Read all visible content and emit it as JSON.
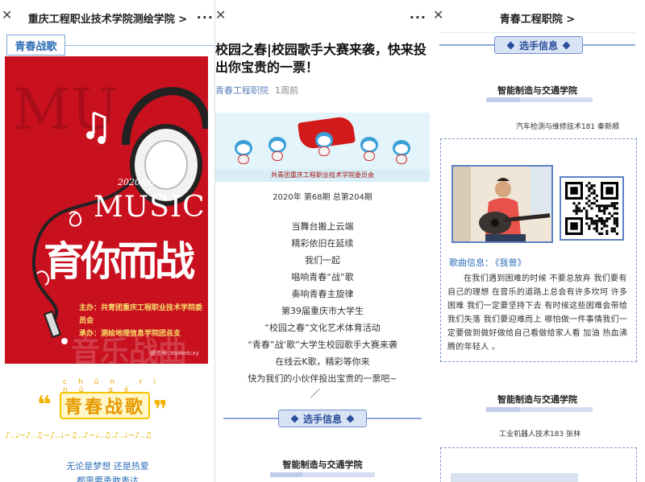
{
  "panel1": {
    "header_title": "重庆工程职业技术学院测绘学院 >",
    "close_glyph": "✕",
    "more_glyph": "···",
    "section_tag": "青春战歌",
    "poster": {
      "date": "2020/06",
      "music": "MUSIC",
      "big_title": "育你而战",
      "organizer": "主办：共青团重庆工程职业技术学院委员会",
      "undertaker": "承办：测绘地理信息学院团总支",
      "wechat": "微信号: cqviedcxy",
      "ghost_text": "音乐战曲"
    },
    "art_title": {
      "pinyin": "chūn rì nǔ gē",
      "text": "青春战歌",
      "quote_left": "❝",
      "quote_right": "❞"
    },
    "notes": "♪..♩~♪..♫~♪..♩~♫..♪~♩..♫.♪..♩~♪..♫",
    "line1": "无论是梦想 还是热爱",
    "line2": "都需要勇敢表达"
  },
  "panel2": {
    "close_glyph": "✕",
    "more_glyph": "···",
    "article_title": "校园之春|校园歌手大赛来袭，快来投出你宝贵的一票！",
    "source": "青春工程职院",
    "time": "1周前",
    "banner_caption": "共青团重庆工程职业技术学院委员会",
    "issue": "2020年 第68期 总第204期",
    "verses": [
      "当舞台搬上云端",
      "精彩依旧在延续",
      "我们一起",
      "唱响青春“战”歌",
      "奏响青春主旋律",
      "第39届重庆市大学生",
      "“校园之春”文化艺术体育活动",
      "“青春”战‘歌”大学生校园歌手大赛来袭",
      "在线云K歌，精彩等你来",
      "快为我们的小伙伴投出宝贵的一票吧~"
    ],
    "slash": "／",
    "section_label": "选手信息",
    "school": "智能制造与交通学院"
  },
  "panel3": {
    "close_glyph": "✕",
    "header_title": "青春工程职院 >",
    "section_label": "选手信息",
    "school1": "智能制造与交通学院",
    "student1": "汽车检测与维修技术181 秦新顺",
    "song_label": "歌曲信息：",
    "song_name": "《我曾》",
    "lyrics": "在我们遇到困难的时候 不要总放弃 我们要有自己的理想 在音乐的道路上总会有许多坎坷 许多困难 我们一定要坚持下去 有时候这些困难会带给我们失落 我们要迎难而上 哪怕做一件事情我们一定要做到做好做给自己看做给家人看 加油 热血沸腾的年轻人 。",
    "school2": "智能制造与交通学院",
    "student2": "工业机器人技术183 张林"
  },
  "colors": {
    "poster_red": "#c8101f",
    "accent_blue": "#2f6fb8",
    "pill_bg": "#d9e3f6",
    "gold": "#f0b400"
  }
}
